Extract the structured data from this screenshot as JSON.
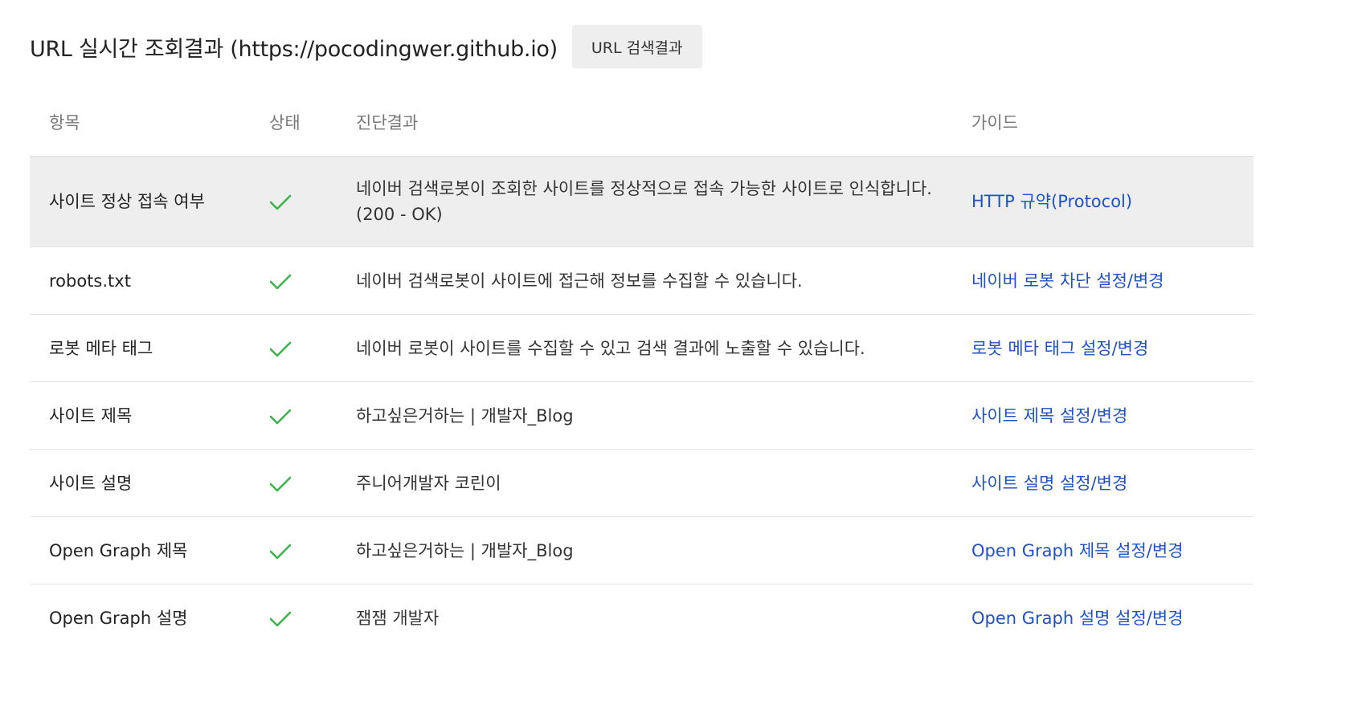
{
  "header": {
    "title": "URL 실시간 조회결과 (https://pocodingwer.github.io)",
    "search_result_button": "URL 검색결과"
  },
  "columns": {
    "item": "항목",
    "status": "상태",
    "result": "진단결과",
    "guide": "가이드"
  },
  "status_icon": "check-icon",
  "colors": {
    "check": "#3cb54a",
    "link": "#1f52c4",
    "highlight_row": "#eeeeee"
  },
  "rows": [
    {
      "item": "사이트 정상 접속 여부",
      "result_line1": "네이버 검색로봇이 조회한 사이트를 정상적으로 접속 가능한 사이트로 인식합니다.",
      "result_line2": "(200 - OK)",
      "guide": "HTTP 규약(Protocol)"
    },
    {
      "item": "robots.txt",
      "result_line1": "네이버 검색로봇이 사이트에 접근해 정보를 수집할 수 있습니다.",
      "guide": "네이버 로봇 차단 설정/변경"
    },
    {
      "item": "로봇 메타 태그",
      "result_line1": "네이버 로봇이 사이트를 수집할 수 있고 검색 결과에 노출할 수 있습니다.",
      "guide": "로봇 메타 태그 설정/변경"
    },
    {
      "item": "사이트 제목",
      "result_line1": "하고싶은거하는 | 개발자_Blog",
      "guide": "사이트 제목 설정/변경"
    },
    {
      "item": "사이트 설명",
      "result_line1": "주니어개발자 코린이",
      "guide": "사이트 설명 설정/변경"
    },
    {
      "item": "Open Graph 제목",
      "result_line1": "하고싶은거하는 | 개발자_Blog",
      "guide": "Open Graph 제목 설정/변경"
    },
    {
      "item": "Open Graph 설명",
      "result_line1": "잼잼 개발자",
      "guide": "Open Graph 설명 설정/변경"
    }
  ]
}
